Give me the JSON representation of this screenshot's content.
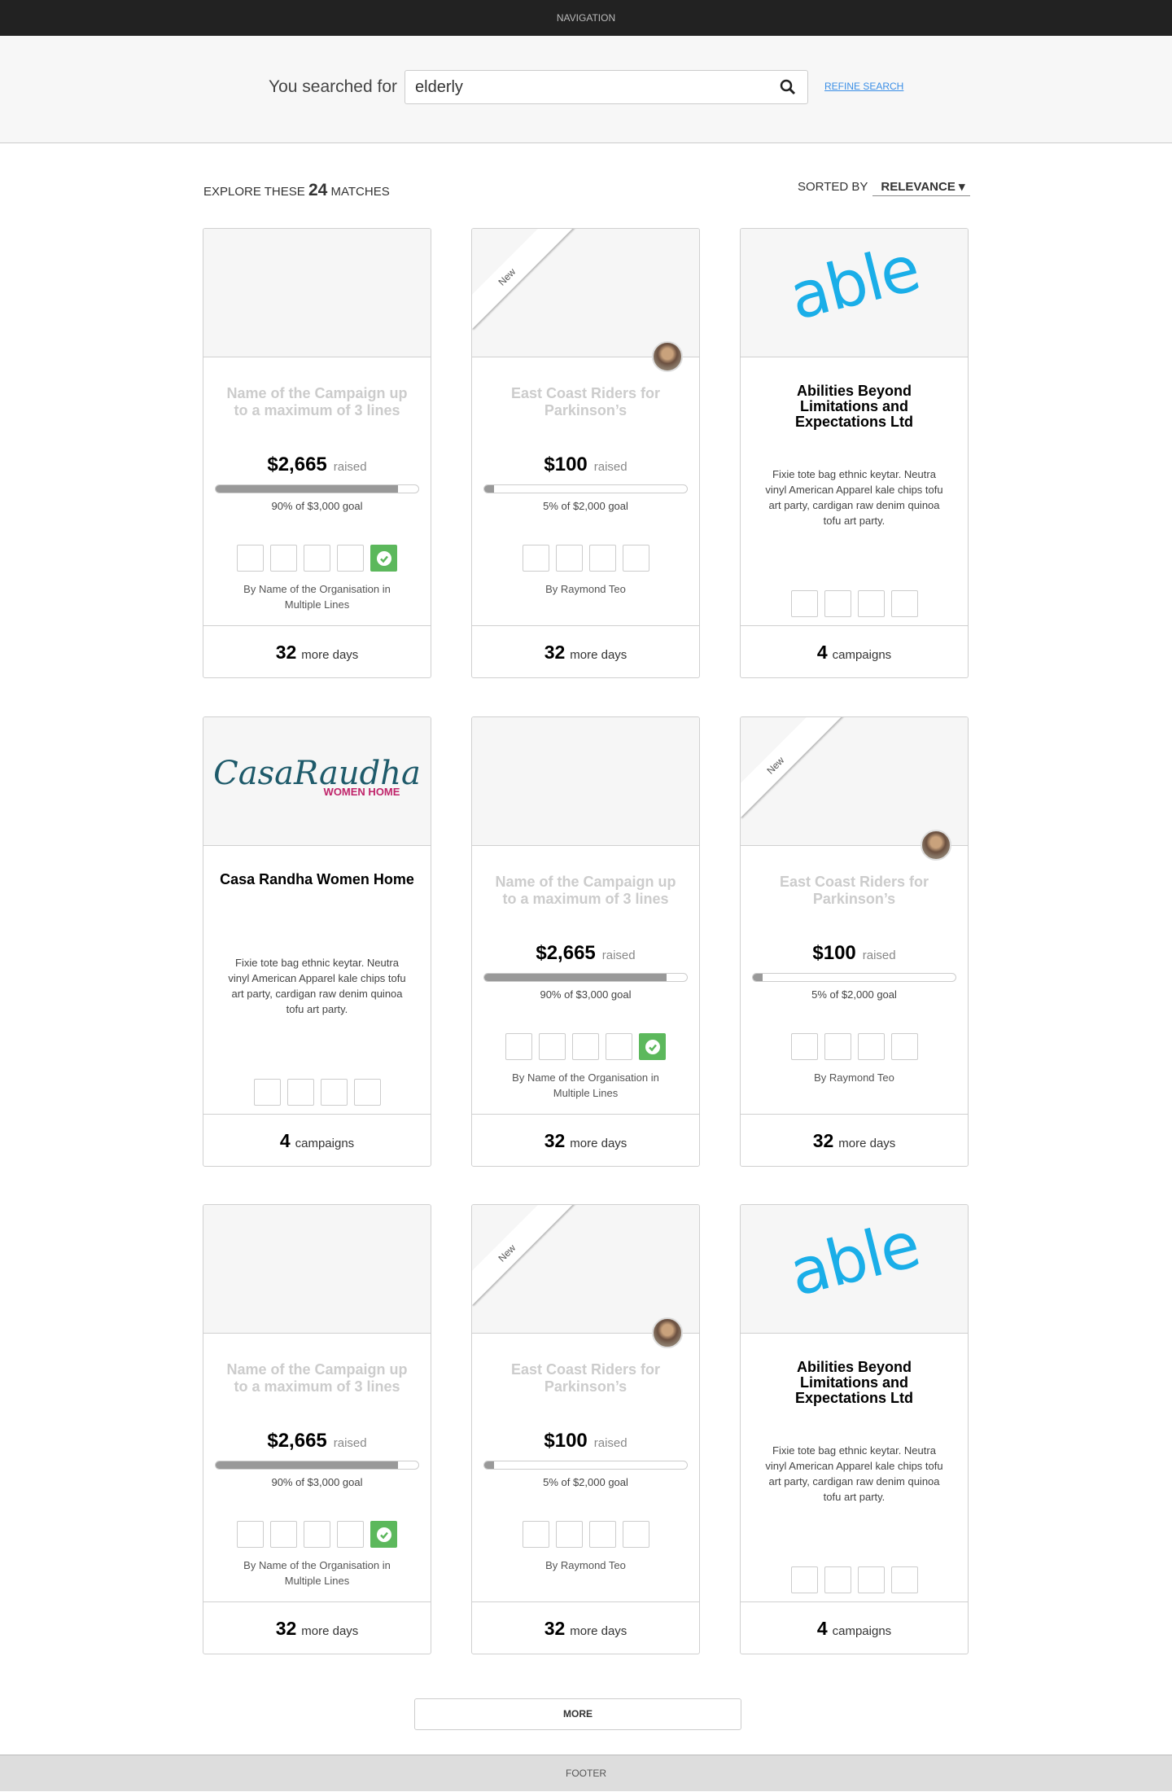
{
  "nav": {
    "label": "NAVIGATION"
  },
  "search": {
    "label": "You searched for",
    "value": "elderly",
    "refine": "REFINE SEARCH"
  },
  "results": {
    "prefix": "EXPLORE THESE",
    "count": "24",
    "suffix": "MATCHES",
    "sorted_label": "SORTED BY",
    "sort_value": "RELEVANCE"
  },
  "colors": {
    "accent": "#3a8ee6",
    "badge_ok": "#5cb85c",
    "able_logo": "#1aaee8",
    "casa_teal": "#1e5a6a",
    "casa_pink": "#c0246a"
  },
  "cards": [
    {
      "type": "campaign",
      "title": "Name of the Campaign up to a maximum of 3 lines",
      "amount": "$2,665",
      "raised": "raised",
      "progress": 90,
      "goal": "90% of $3,000 goal",
      "badges": 5,
      "verified": true,
      "by": "By Name of the Organisation in Multiple Lines",
      "foot_num": "32",
      "foot_text": "more days"
    },
    {
      "type": "campaign",
      "new": "New",
      "avatar": true,
      "title": "East Coast Riders for Parkinson’s",
      "amount": "$100",
      "raised": "raised",
      "progress": 5,
      "goal": "5% of $2,000 goal",
      "badges": 4,
      "verified": false,
      "by": "By Raymond Teo",
      "foot_num": "32",
      "foot_text": "more days"
    },
    {
      "type": "org",
      "logo": "able",
      "logo_text": "able",
      "title": "Abilities Beyond Limitations and Expectations Ltd",
      "desc": "Fixie tote bag ethnic keytar. Neutra vinyl American Apparel kale chips tofu art party, cardigan raw denim quinoa tofu art party.",
      "badges": 4,
      "foot_num": "4",
      "foot_text": "campaigns"
    },
    {
      "type": "org",
      "logo": "casa",
      "logo_text": "CasaRaudha",
      "logo_sub": "WOMEN HOME",
      "title": "Casa Randha Women Home",
      "desc": "Fixie tote bag ethnic keytar. Neutra vinyl American Apparel kale chips tofu art party, cardigan raw denim quinoa tofu art party.",
      "badges": 4,
      "foot_num": "4",
      "foot_text": "campaigns"
    },
    {
      "type": "campaign",
      "title": "Name of the Campaign up to a maximum of 3 lines",
      "amount": "$2,665",
      "raised": "raised",
      "progress": 90,
      "goal": "90% of $3,000 goal",
      "badges": 5,
      "verified": true,
      "by": "By Name of the Organisation in Multiple Lines",
      "foot_num": "32",
      "foot_text": "more days"
    },
    {
      "type": "campaign",
      "new": "New",
      "avatar": true,
      "title": "East Coast Riders for Parkinson’s",
      "amount": "$100",
      "raised": "raised",
      "progress": 5,
      "goal": "5% of $2,000 goal",
      "badges": 4,
      "verified": false,
      "by": "By Raymond Teo",
      "foot_num": "32",
      "foot_text": "more days"
    },
    {
      "type": "campaign",
      "title": "Name of the Campaign up to a maximum of 3 lines",
      "amount": "$2,665",
      "raised": "raised",
      "progress": 90,
      "goal": "90% of $3,000 goal",
      "badges": 5,
      "verified": true,
      "by": "By Name of the Organisation in Multiple Lines",
      "foot_num": "32",
      "foot_text": "more days"
    },
    {
      "type": "campaign",
      "new": "New",
      "avatar": true,
      "title": "East Coast Riders for Parkinson’s",
      "amount": "$100",
      "raised": "raised",
      "progress": 5,
      "goal": "5% of $2,000 goal",
      "badges": 4,
      "verified": false,
      "by": "By Raymond Teo",
      "foot_num": "32",
      "foot_text": "more days"
    },
    {
      "type": "org",
      "logo": "able",
      "logo_text": "able",
      "title": "Abilities Beyond Limitations and Expectations Ltd",
      "desc": "Fixie tote bag ethnic keytar. Neutra vinyl American Apparel kale chips tofu art party, cardigan raw denim quinoa tofu art party.",
      "badges": 4,
      "foot_num": "4",
      "foot_text": "campaigns"
    }
  ],
  "more": "MORE",
  "footer": "FOOTER"
}
